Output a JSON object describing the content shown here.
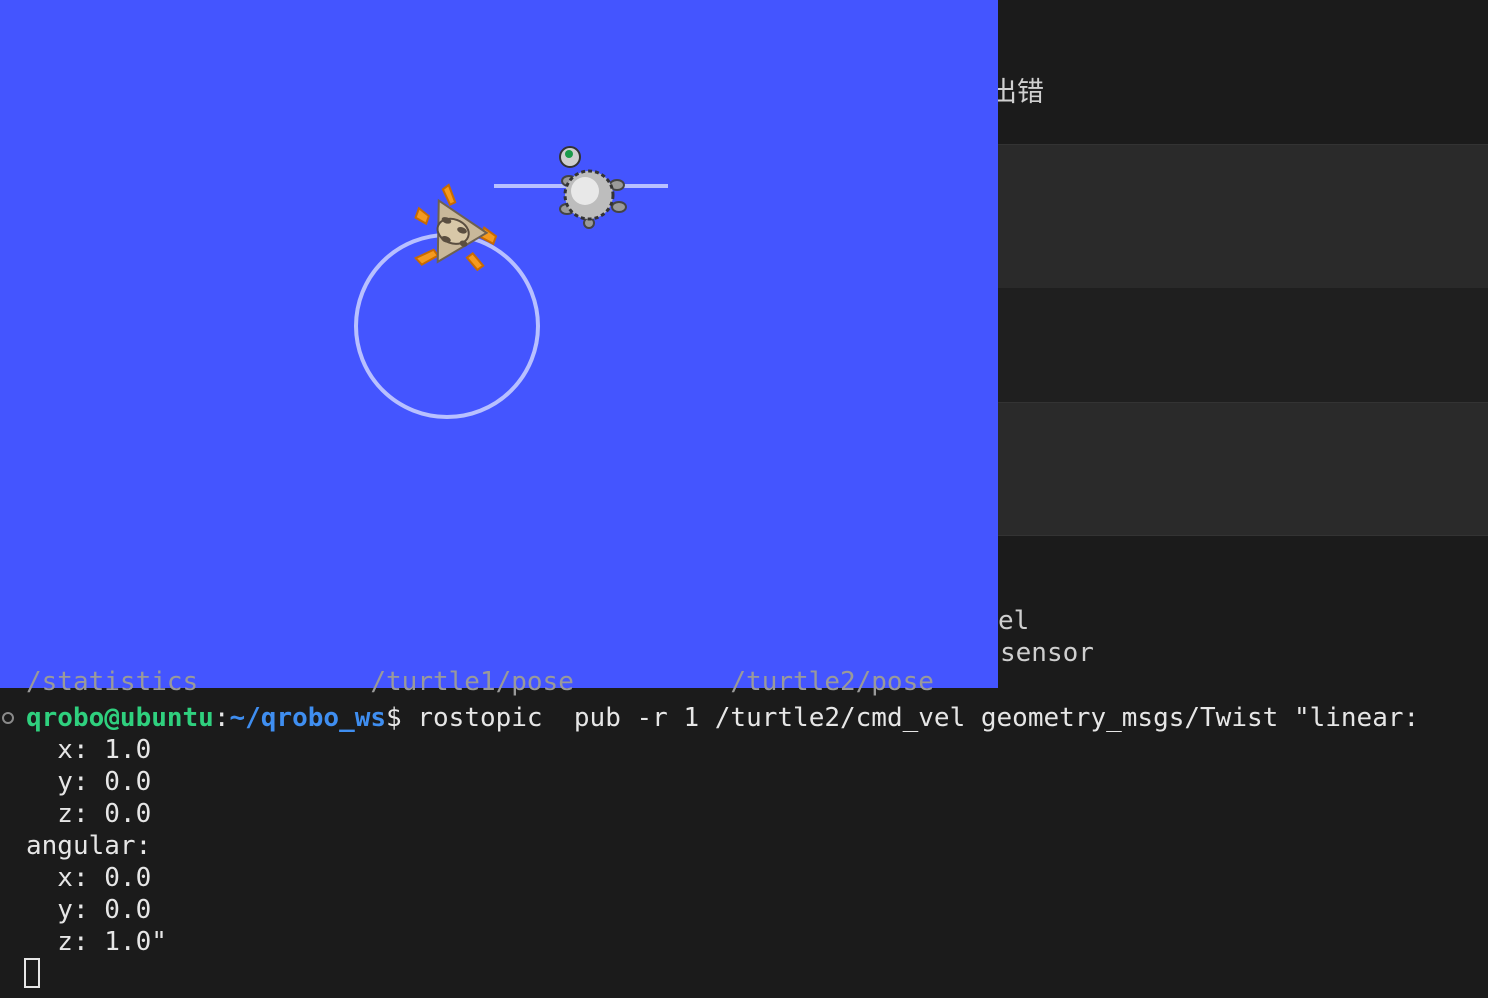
{
  "background_editor": {
    "partial_heading": "出错",
    "partial_terms": [
      "el",
      "sensor"
    ]
  },
  "turtlesim": {
    "background_color": "#4455ff",
    "pen_color": "#b8c0ff",
    "turtle1_icon": "orange-turtle-icon",
    "turtle2_icon": "grey-turtle-icon"
  },
  "terminal": {
    "clipped_line": "/statistics           /turtle1/pose          /turtle2/pose",
    "prompt": {
      "user_host": "qrobo@ubuntu",
      "separator": ":",
      "path": "~/qrobo_ws",
      "symbol": "$ ",
      "command": "rostopic  pub -r 1 /turtle2/cmd_vel geometry_msgs/Twist \"linear:"
    },
    "output_lines": [
      "  x: 1.0",
      "  y: 0.0",
      "  z: 0.0",
      "angular:",
      "  x: 0.0",
      "  y: 0.0",
      "  z: 1.0\""
    ]
  }
}
